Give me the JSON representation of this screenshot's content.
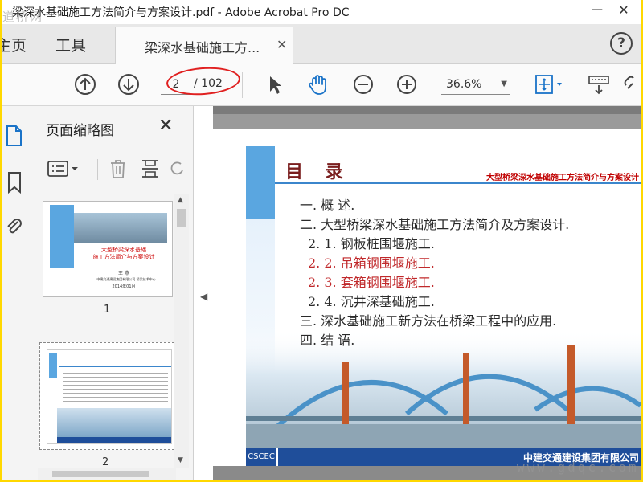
{
  "window": {
    "title": "梁深水基础施工方法简介与方案设计.pdf - Adobe Acrobat Pro DC",
    "watermark_top": "道桥网",
    "watermark_bottom": "www.gdqc.com"
  },
  "tabs": {
    "home": "主页",
    "tools": "工具",
    "document": "梁深水基础施工方..."
  },
  "toolbar": {
    "current_page": "2",
    "total_pages": "/ 102",
    "zoom": "36.6%"
  },
  "thumbnail_panel": {
    "title": "页面缩略图",
    "thumbnails": [
      {
        "number": "1",
        "title": "大型桥梁深水基础\n施工方法简介与方案设计",
        "author": "王 燕",
        "org": "中建交通建设集团有限公司 桥梁技术中心",
        "date": "2014年01月"
      },
      {
        "number": "2"
      }
    ]
  },
  "page": {
    "heading": "目 录",
    "subtitle": "大型桥梁深水基础施工方法简介与方案设计",
    "toc": [
      {
        "text": "一. 概 述.",
        "color": "#2a2a2a",
        "indent": 0
      },
      {
        "text": "二. 大型桥梁深水基础施工方法简介及方案设计.",
        "color": "#2a2a2a",
        "indent": 0
      },
      {
        "text": "2. 1. 钢板桩围堰施工.",
        "color": "#2a2a2a",
        "indent": 1
      },
      {
        "text": "2. 2. 吊箱钢围堰施工.",
        "color": "#c0282a",
        "indent": 1
      },
      {
        "text": "2. 3. 套箱钢围堰施工.",
        "color": "#c0282a",
        "indent": 1
      },
      {
        "text": "2. 4. 沉井深基础施工.",
        "color": "#2a2a2a",
        "indent": 1
      },
      {
        "text": "三.  深水基础施工新方法在桥梁工程中的应用.",
        "color": "#2a2a2a",
        "indent": 0
      },
      {
        "text": "四. 结 语.",
        "color": "#2a2a2a",
        "indent": 0
      }
    ],
    "company": "中建交通建设集团有限公司",
    "logo": "CSCEC"
  },
  "colors": {
    "accent_blue": "#3b86cc",
    "toc_red": "#c0282a",
    "annotation_red": "#e02020"
  }
}
